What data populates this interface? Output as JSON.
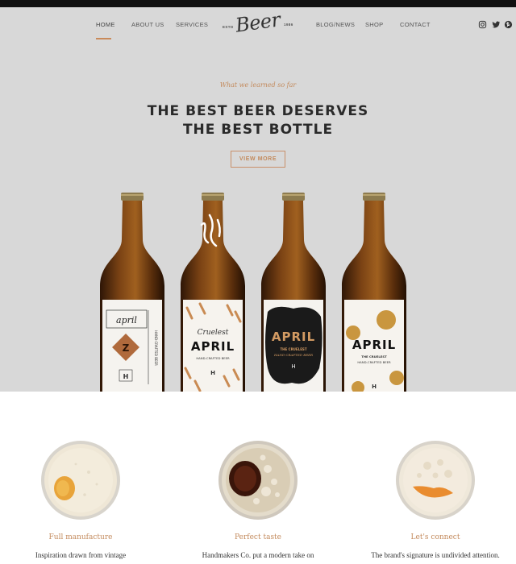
{
  "nav": {
    "left": [
      "HOME",
      "ABOUT US",
      "SERVICES"
    ],
    "right": [
      "BLOG/NEWS",
      "SHOP",
      "CONTACT"
    ],
    "active": "HOME"
  },
  "logo": {
    "script": "Beer",
    "est": "ESTD",
    "year": "1986"
  },
  "social_icons": [
    "instagram-icon",
    "twitter-icon",
    "pinterest-icon"
  ],
  "hero": {
    "eyebrow": "What we learned so far",
    "title_line1": "THE BEST BEER DESERVES",
    "title_line2": "THE BEST BOTTLE",
    "button_label": "VIEW MORE"
  },
  "bottles": [
    {
      "brand": "april",
      "style": "script",
      "mark": "H",
      "side_text": "HAND-CRAFTED BEER"
    },
    {
      "brand": "APRIL",
      "style": "runic",
      "script": "Cruelest",
      "sub": "HAND-CRAFTED BEER",
      "mark": "H"
    },
    {
      "brand": "APRIL",
      "style": "dark",
      "sub1": "THE CRUELEST",
      "sub2": "HAND-CRAFTED BEER",
      "mark": "H"
    },
    {
      "brand": "APRIL",
      "style": "dots",
      "sub1": "THE CRUELEST",
      "sub2": "HAND-CRAFTED BEER",
      "mark": "H"
    }
  ],
  "features": [
    {
      "title": "Full manufacture",
      "text": "Inspiration drawn from vintage"
    },
    {
      "title": "Perfect taste",
      "text": "Handmakers Co. put a modern take on"
    },
    {
      "title": "Let's connect",
      "text": "The brand's signature is undivided attention."
    }
  ],
  "colors": {
    "accent": "#c38a5c",
    "hero_bg": "#d8d8d8",
    "topbar": "#111111"
  }
}
